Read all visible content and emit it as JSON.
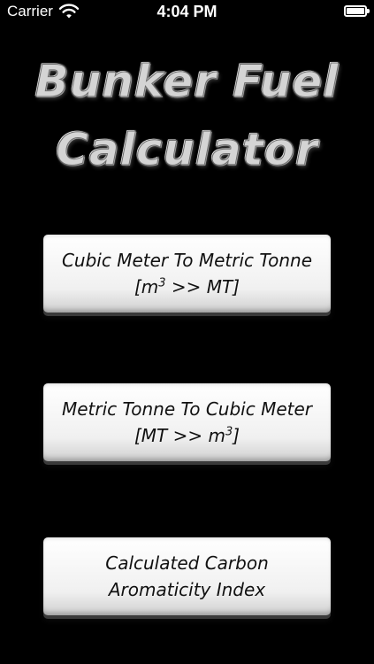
{
  "status_bar": {
    "carrier": "Carrier",
    "time": "4:04 PM"
  },
  "title": {
    "line1": "Bunker Fuel",
    "line2": "Calculator"
  },
  "buttons": [
    {
      "line1": "Cubic Meter To Metric Tonne",
      "line2_pre": "[m",
      "line2_sup": "3",
      "line2_post": " >> MT]"
    },
    {
      "line1": "Metric Tonne To Cubic Meter",
      "line2_pre": "[MT >> m",
      "line2_sup": "3",
      "line2_post": "]"
    },
    {
      "line1": "Calculated Carbon",
      "line2": "Aromaticity Index"
    }
  ],
  "colors": {
    "background": "#000000",
    "button_face": "#f5f5f5",
    "title_metal": "#d4d4d4"
  },
  "icons": [
    "wifi-icon",
    "battery-icon"
  ]
}
